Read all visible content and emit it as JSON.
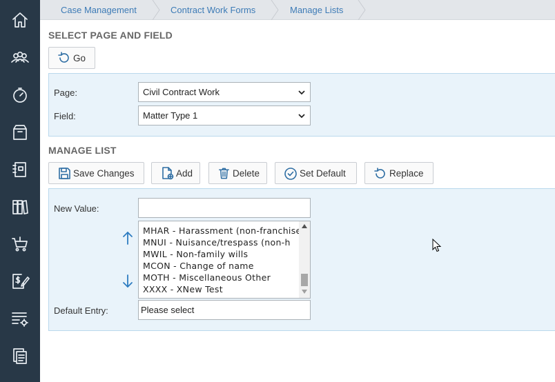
{
  "sidebar": {
    "items": [
      {
        "icon": "home-icon"
      },
      {
        "icon": "people-icon"
      },
      {
        "icon": "time-icon"
      },
      {
        "icon": "archive-box-icon"
      },
      {
        "icon": "notebook-icon"
      },
      {
        "icon": "library-icon"
      },
      {
        "icon": "cart-icon"
      },
      {
        "icon": "billing-icon"
      },
      {
        "icon": "list-settings-icon"
      },
      {
        "icon": "documents-icon"
      }
    ]
  },
  "breadcrumb": [
    "Case Management",
    "Contract Work Forms",
    "Manage Lists"
  ],
  "select_section": {
    "title": "SELECT PAGE AND FIELD",
    "go_label": "Go",
    "page_label": "Page:",
    "page_value": "Civil Contract Work",
    "field_label": "Field:",
    "field_value": "Matter Type 1"
  },
  "manage_section": {
    "title": "MANAGE LIST",
    "toolbar": {
      "save": "Save Changes",
      "add": "Add",
      "delete": "Delete",
      "set_default": "Set Default",
      "replace": "Replace"
    },
    "new_value_label": "New Value:",
    "new_value": "",
    "list_items": [
      "MHAR - Harassment (non-franchise)",
      "MNUI - Nuisance/trespass (non-h",
      "MWIL - Non-family wills",
      "MCON - Change of name",
      "MOTH - Miscellaneous Other",
      "XXXX - XNew Test"
    ],
    "default_entry_label": "Default Entry:",
    "default_entry_value": "Please select"
  },
  "colors": {
    "sidebar": "#283847",
    "accent": "#2d6da3",
    "link": "#3d7bb6",
    "panel_bg": "#e9f3fa"
  }
}
